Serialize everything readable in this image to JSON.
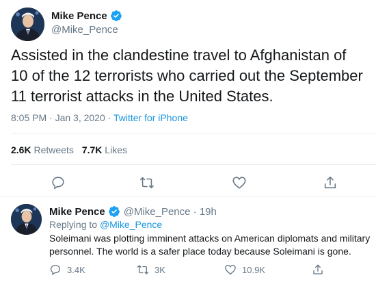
{
  "main_tweet": {
    "author_name": "Mike Pence",
    "author_handle": "@Mike_Pence",
    "text": "Assisted in the clandestine travel to Afghanistan of 10 of the 12 terrorists who carried out the September 11 terrorist attacks in the United States.",
    "time": "8:05 PM · Jan 3, 2020 · ",
    "source": "Twitter for iPhone",
    "retweets_count": "2.6K",
    "retweets_label": "Retweets",
    "likes_count": "7.7K",
    "likes_label": "Likes"
  },
  "reply_tweet": {
    "author_name": "Mike Pence",
    "author_handle_time": "@Mike_Pence · 19h",
    "replying_prefix": "Replying to ",
    "replying_to": "@Mike_Pence",
    "text": "Soleimani was plotting imminent attacks on American diplomats and military personnel. The world is a safer place today because Soleimani is gone.",
    "replies_count": "3.4K",
    "retweets_count": "3K",
    "likes_count": "10.9K"
  },
  "colors": {
    "accent": "#1da1f2",
    "link": "#1b95e0",
    "secondary_text": "#657786",
    "primary_text": "#14171a",
    "border": "#e6ecf0"
  },
  "icons": [
    "verified-badge-icon",
    "reply-icon",
    "retweet-icon",
    "like-icon",
    "share-icon"
  ]
}
